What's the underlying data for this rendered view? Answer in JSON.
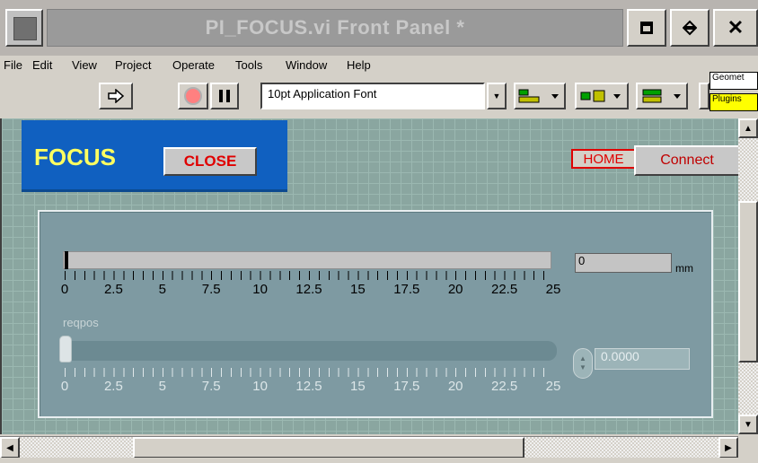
{
  "window": {
    "title": "PI_FOCUS.vi Front Panel *",
    "min_icon": "minimize-icon",
    "max_icon": "maximize-icon",
    "close_label": "✕"
  },
  "menu": {
    "items": [
      "File",
      "Edit",
      "View",
      "Project",
      "Operate",
      "Tools",
      "Window",
      "Help"
    ]
  },
  "toolbar": {
    "font": "10pt Application Font",
    "palette_geometry": "Geomet",
    "palette_plugins": "Plugins"
  },
  "panel": {
    "title": "FOCUS",
    "close_label": "CLOSE",
    "home_label": "HOME",
    "connect_label": "Connect",
    "position": {
      "value": "0",
      "unit": "mm",
      "fraction": 0,
      "ticks": [
        "0",
        "2.5",
        "5",
        "7.5",
        "10",
        "12.5",
        "15",
        "17.5",
        "20",
        "22.5",
        "25"
      ]
    },
    "reqpos": {
      "label": "reqpos",
      "value": "0.0000",
      "fraction": 0,
      "ticks": [
        "0",
        "2.5",
        "5",
        "7.5",
        "10",
        "12.5",
        "15",
        "17.5",
        "20",
        "22.5",
        "25"
      ]
    }
  },
  "colors": {
    "header_blue": "#1060c0",
    "title_yellow": "#ffff60",
    "alert_red": "#e00000",
    "panel_teal": "#8aa6a0"
  }
}
